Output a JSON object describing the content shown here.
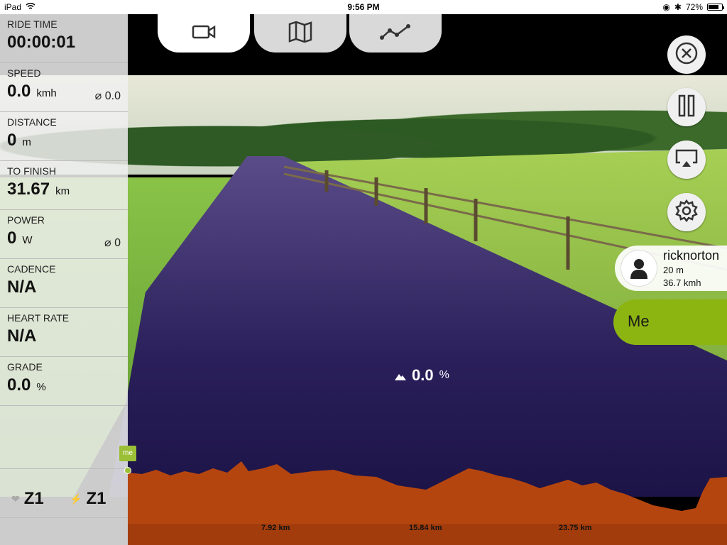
{
  "status_bar": {
    "device": "iPad",
    "time": "9:56 PM",
    "battery": "72%"
  },
  "tabs": [
    {
      "id": "video",
      "icon": "video-camera-icon",
      "active": true
    },
    {
      "id": "map",
      "icon": "map-icon",
      "active": false
    },
    {
      "id": "profile",
      "icon": "chart-line-icon",
      "active": false
    }
  ],
  "metrics": {
    "ride_time": {
      "label": "RIDE TIME",
      "value": "00:00:01"
    },
    "speed": {
      "label": "SPEED",
      "value": "0.0",
      "unit": "kmh",
      "avg": "⌀ 0.0"
    },
    "distance": {
      "label": "DISTANCE",
      "value": "0",
      "unit": "m"
    },
    "to_finish": {
      "label": "TO FINISH",
      "value": "31.67",
      "unit": "km"
    },
    "power": {
      "label": "POWER",
      "value": "0",
      "unit": "W",
      "avg": "⌀ 0"
    },
    "cadence": {
      "label": "CADENCE",
      "value": "N/A"
    },
    "heart_rate": {
      "label": "HEART RATE",
      "value": "N/A"
    },
    "grade": {
      "label": "GRADE",
      "value": "0.0",
      "unit": "%"
    }
  },
  "zones": {
    "heart": "Z1",
    "power": "Z1"
  },
  "controls": {
    "close": "close-icon",
    "pause": "pause-icon",
    "airplay": "airplay-icon",
    "settings": "gear-icon"
  },
  "rider": {
    "name": "ricknorton",
    "distance": "20 m",
    "speed": "36.7 kmh"
  },
  "me_label": "Me",
  "current_grade": {
    "value": "0.0",
    "unit": "%"
  },
  "elevation": {
    "marker_label": "me",
    "distance_labels": [
      "7.92 km",
      "15.84 km",
      "23.75 km"
    ],
    "fill_color": "#b5450f"
  }
}
